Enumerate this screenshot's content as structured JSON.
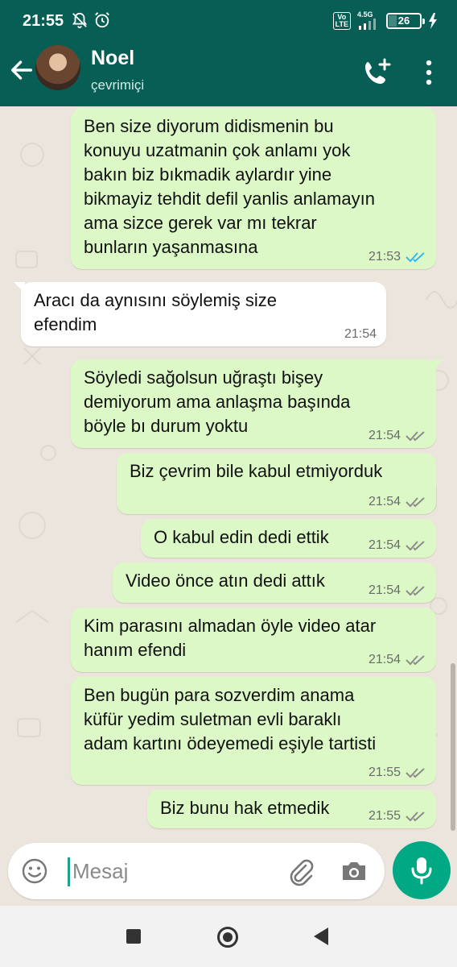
{
  "status_bar": {
    "time": "21:55",
    "volte_label": "Vo\nLTE",
    "network_label": "4.5G",
    "battery_level": "26"
  },
  "contact": {
    "name": "Noel",
    "status": "çevrimiçi"
  },
  "colors": {
    "header": "#075e54",
    "outgoing_bubble": "#dcf8c6",
    "incoming_bubble": "#ffffff",
    "read_ticks": "#34b7f1",
    "delivered_ticks": "#8c8c8c",
    "accent": "#00a884"
  },
  "icons": {
    "back": "arrow-left-icon",
    "add_call": "phone-plus-icon",
    "menu": "more-vertical-icon",
    "emoji": "emoji-icon",
    "attach": "paperclip-icon",
    "camera": "camera-icon",
    "mic": "microphone-icon"
  },
  "messages": [
    {
      "direction": "out",
      "text": "Ben size diyorum didismenin bu\nkonuyu uzatmanin çok anlamı yok\nbakın biz bıkmadik aylardır yine\nbikmayiz tehdit defil yanlis anlamayın\nama sizce gerek var mı tekrar\nbunların yaşanmasına",
      "time": "21:53",
      "ticks": "read"
    },
    {
      "direction": "in",
      "text": "Aracı da aynısını söylemiş size\nefendim",
      "time": "21:54"
    },
    {
      "direction": "out",
      "text": "Söyledi sağolsun uğraştı bişey\ndemiyorum ama anlaşma başında\nböyle bı durum yoktu",
      "time": "21:54",
      "ticks": "delivered"
    },
    {
      "direction": "out",
      "text": "Biz çevrim bile kabul etmiyorduk",
      "time": "21:54",
      "ticks": "delivered"
    },
    {
      "direction": "out",
      "text": "O kabul edin dedi ettik",
      "time": "21:54",
      "ticks": "delivered"
    },
    {
      "direction": "out",
      "text": "Video önce atın dedi attık",
      "time": "21:54",
      "ticks": "delivered"
    },
    {
      "direction": "out",
      "text": "Kim parasını almadan öyle video atar\nhanım efendi",
      "time": "21:54",
      "ticks": "delivered"
    },
    {
      "direction": "out",
      "text": "Ben bugün para sozverdim anama\nküfür yedim suletman evli baraklı\nadam kartını ödeyemedi eşiyle tartisti",
      "time": "21:55",
      "ticks": "delivered"
    },
    {
      "direction": "out",
      "text": "Biz bunu hak etmedik",
      "time": "21:55",
      "ticks": "delivered"
    }
  ],
  "composer": {
    "placeholder": "Mesaj"
  }
}
